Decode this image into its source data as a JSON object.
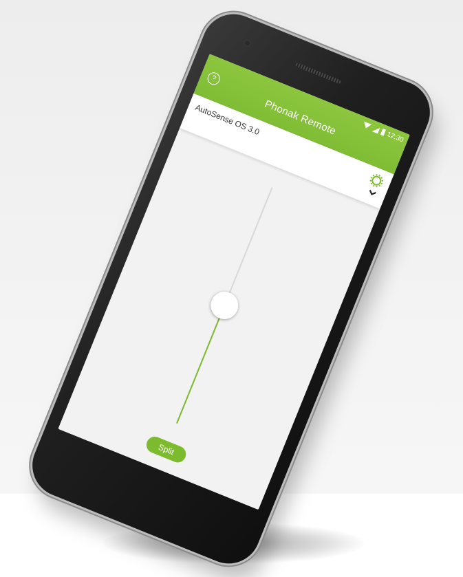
{
  "statusbar": {
    "time": "12:30",
    "wifi_icon": "wifi-icon",
    "signal_icon": "signal-icon",
    "battery_icon": "battery-icon"
  },
  "header": {
    "title": "Phonak Remote",
    "help_label": "?",
    "background": "#8cc63e"
  },
  "program": {
    "name": "AutoSense OS 3.0",
    "settings_icon": "gear-icon",
    "dropdown_icon": "chevron-down-icon"
  },
  "volume_slider": {
    "level": 0.5,
    "fill_color": "#7cbb2e",
    "track_color": "#d8d8d8"
  },
  "split_button": {
    "label": "Split",
    "color": "#7cbb2e"
  }
}
